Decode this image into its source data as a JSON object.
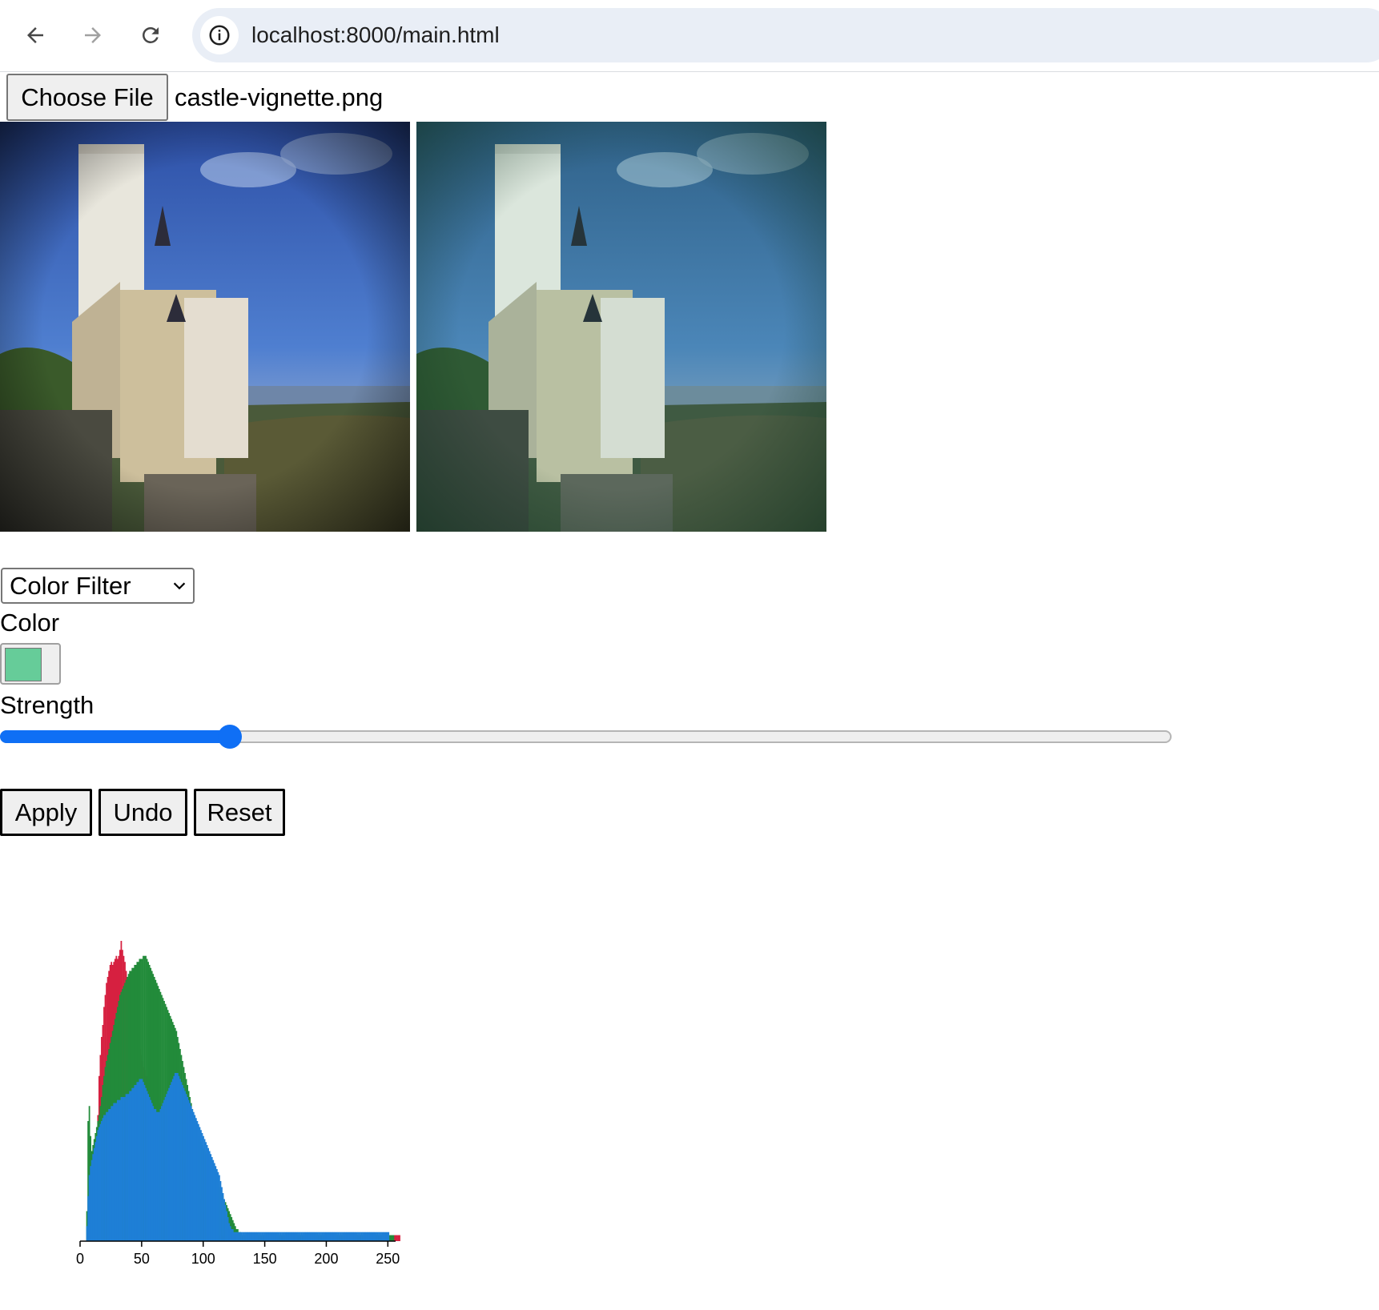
{
  "browser": {
    "url": "localhost:8000/main.html",
    "icons": [
      "back-arrow-icon",
      "forward-arrow-icon",
      "reload-icon",
      "site-info-icon"
    ]
  },
  "file_input": {
    "button_label": "Choose File",
    "file_name": "castle-vignette.png"
  },
  "filter": {
    "selected": "Color Filter",
    "color_label": "Color",
    "color_value": "#66cc99",
    "strength_label": "Strength",
    "strength_fraction": 0.19
  },
  "actions": {
    "apply_label": "Apply",
    "undo_label": "Undo",
    "reset_label": "Reset"
  },
  "chart_data": {
    "type": "bar",
    "title": "",
    "xlabel": "",
    "ylabel": "",
    "xlim": [
      0,
      255
    ],
    "x_ticks": [
      "0",
      "50",
      "100",
      "150",
      "200",
      "250"
    ],
    "series": [
      {
        "color": "#d62040",
        "values": [
          0,
          0,
          0,
          0,
          0,
          0,
          0,
          0,
          0,
          0,
          0.05,
          0.08,
          0.15,
          0.28,
          0.42,
          0.55,
          0.62,
          0.68,
          0.72,
          0.78,
          0.82,
          0.86,
          0.88,
          0.9,
          0.92,
          0.93,
          0.92,
          0.93,
          0.94,
          0.95,
          0.94,
          0.95,
          0.97,
          1.0,
          0.97,
          0.95,
          0.93,
          0.9,
          0.88,
          0.86,
          0.84,
          0.82,
          0.8,
          0.76,
          0.72,
          0.7,
          0.68,
          0.65,
          0.64,
          0.62,
          0.6,
          0.58,
          0.57,
          0.55,
          0.55,
          0.54,
          0.53,
          0.52,
          0.52,
          0.5,
          0.5,
          0.49,
          0.48,
          0.47,
          0.46,
          0.45,
          0.45,
          0.44,
          0.43,
          0.42,
          0.41,
          0.4,
          0.39,
          0.38,
          0.37,
          0.36,
          0.35,
          0.34,
          0.33,
          0.32,
          0.31,
          0.3,
          0.29,
          0.28,
          0.27,
          0.26,
          0.25,
          0.24,
          0.23,
          0.22,
          0.21,
          0.2,
          0.19,
          0.18,
          0.17,
          0.16,
          0.15,
          0.14,
          0.13,
          0.12,
          0.11,
          0.1,
          0.09,
          0.08,
          0.07,
          0.06,
          0.05,
          0.05,
          0.04,
          0.04,
          0.03,
          0.03,
          0.03,
          0.02,
          0.02,
          0.02,
          0.02,
          0.02,
          0.02,
          0.02,
          0.02,
          0.02,
          0.02,
          0.02,
          0.02,
          0.02,
          0.02,
          0.02,
          0.02,
          0.02,
          0.02,
          0.02,
          0.02,
          0.02,
          0.02,
          0.02,
          0.02,
          0.02,
          0.02,
          0.02,
          0.02,
          0.02,
          0.02,
          0.02,
          0.02,
          0.02,
          0.02,
          0.02,
          0.02,
          0.02,
          0.02,
          0.02,
          0.02,
          0.02,
          0.02,
          0.02,
          0.02,
          0.02,
          0.02,
          0.02,
          0.02,
          0.02,
          0.02,
          0.02,
          0.02,
          0.02,
          0.02,
          0.02,
          0.02,
          0.02,
          0.02,
          0.02,
          0.02,
          0.02,
          0.02,
          0.02,
          0.02,
          0.02,
          0.02,
          0.02,
          0.02,
          0.02,
          0.02,
          0.02,
          0.02,
          0.02,
          0.02,
          0.02,
          0.02,
          0.02,
          0.02,
          0.02,
          0.02,
          0.02,
          0.02,
          0.02,
          0.02,
          0.02,
          0.02,
          0.02,
          0.02,
          0.02,
          0.02,
          0.02,
          0.02,
          0.02,
          0.02,
          0.02,
          0.02,
          0.02,
          0.02,
          0.02,
          0.02,
          0.02,
          0.02,
          0.02,
          0.02,
          0.02,
          0.02,
          0.02,
          0.02,
          0.02,
          0.02,
          0.02,
          0.02,
          0.02,
          0.02,
          0.02,
          0.02,
          0.02,
          0.02,
          0.02,
          0.02,
          0.02,
          0.02,
          0.02,
          0.02,
          0.02,
          0.02,
          0.02,
          0.02,
          0.02,
          0.02,
          0.02,
          0.02,
          0.02,
          0.02,
          0.02,
          0.02,
          0.02,
          0.02,
          0.02,
          0.02,
          0.02,
          0.02,
          0.02,
          0.02,
          0.02,
          0.02,
          0.02,
          0.02
        ]
      },
      {
        "color": "#228b3a",
        "values": [
          0,
          0,
          0,
          0,
          0,
          0.1,
          0.4,
          0.45,
          0.35,
          0.3,
          0.32,
          0.34,
          0.36,
          0.38,
          0.4,
          0.42,
          0.45,
          0.48,
          0.52,
          0.55,
          0.58,
          0.6,
          0.62,
          0.64,
          0.66,
          0.68,
          0.7,
          0.72,
          0.74,
          0.76,
          0.78,
          0.8,
          0.82,
          0.83,
          0.84,
          0.85,
          0.86,
          0.87,
          0.88,
          0.89,
          0.9,
          0.9,
          0.91,
          0.91,
          0.92,
          0.92,
          0.93,
          0.93,
          0.94,
          0.94,
          0.94,
          0.95,
          0.95,
          0.95,
          0.94,
          0.93,
          0.92,
          0.91,
          0.9,
          0.89,
          0.88,
          0.87,
          0.86,
          0.85,
          0.84,
          0.83,
          0.82,
          0.81,
          0.8,
          0.79,
          0.78,
          0.77,
          0.76,
          0.75,
          0.74,
          0.73,
          0.72,
          0.71,
          0.7,
          0.68,
          0.66,
          0.64,
          0.62,
          0.6,
          0.58,
          0.56,
          0.54,
          0.52,
          0.5,
          0.48,
          0.46,
          0.44,
          0.42,
          0.4,
          0.38,
          0.36,
          0.35,
          0.34,
          0.33,
          0.32,
          0.31,
          0.3,
          0.29,
          0.28,
          0.27,
          0.26,
          0.25,
          0.24,
          0.23,
          0.22,
          0.21,
          0.2,
          0.19,
          0.18,
          0.17,
          0.16,
          0.15,
          0.14,
          0.13,
          0.12,
          0.11,
          0.1,
          0.09,
          0.08,
          0.07,
          0.06,
          0.05,
          0.04,
          0.04,
          0.03,
          0.03,
          0.02,
          0.02,
          0.02,
          0.02,
          0.02,
          0.02,
          0.02,
          0.02,
          0.02,
          0.02,
          0.02,
          0.02,
          0.02,
          0.02,
          0.02,
          0.02,
          0.02,
          0.02,
          0.02,
          0.02,
          0.02,
          0.02,
          0.02,
          0.02,
          0.02,
          0.02,
          0.02,
          0.02,
          0.02,
          0.02,
          0.02,
          0.02,
          0.02,
          0.02,
          0.02,
          0.02,
          0.02,
          0.02,
          0.02,
          0.02,
          0.02,
          0.02,
          0.02,
          0.02,
          0.02,
          0.02,
          0.02,
          0.02,
          0.02,
          0.02,
          0.02,
          0.02,
          0.02,
          0.02,
          0.02,
          0.02,
          0.02,
          0.02,
          0.02,
          0.02,
          0.02,
          0.02,
          0.02,
          0.02,
          0.02,
          0.02,
          0.02,
          0.02,
          0.02,
          0.02,
          0.02,
          0.02,
          0.02,
          0.02,
          0.02,
          0.02,
          0.02,
          0.02,
          0.02,
          0.02,
          0.02,
          0.02,
          0.02,
          0.02,
          0.02,
          0.02,
          0.02,
          0.02,
          0.02,
          0.02,
          0.02,
          0.02,
          0.02,
          0.02,
          0.02,
          0.02,
          0.02,
          0.02,
          0.02,
          0.02,
          0.02,
          0.02,
          0.02,
          0.02,
          0.02,
          0.02,
          0.02,
          0.02,
          0.02,
          0.02,
          0.02,
          0.02,
          0.02,
          0.02,
          0.02,
          0.02,
          0.02,
          0.02,
          0.02,
          0.02,
          0.02,
          0.02,
          0.02,
          0.02,
          0.02
        ]
      },
      {
        "color": "#1e7fd6",
        "values": [
          0,
          0,
          0,
          0,
          0,
          0.05,
          0.15,
          0.22,
          0.25,
          0.27,
          0.29,
          0.31,
          0.33,
          0.35,
          0.37,
          0.38,
          0.39,
          0.4,
          0.41,
          0.42,
          0.42,
          0.43,
          0.43,
          0.44,
          0.44,
          0.45,
          0.45,
          0.46,
          0.46,
          0.46,
          0.47,
          0.47,
          0.47,
          0.48,
          0.48,
          0.48,
          0.48,
          0.49,
          0.49,
          0.49,
          0.5,
          0.5,
          0.51,
          0.51,
          0.52,
          0.52,
          0.53,
          0.53,
          0.54,
          0.54,
          0.54,
          0.53,
          0.52,
          0.51,
          0.5,
          0.49,
          0.48,
          0.47,
          0.46,
          0.45,
          0.44,
          0.44,
          0.43,
          0.43,
          0.43,
          0.44,
          0.45,
          0.46,
          0.47,
          0.48,
          0.49,
          0.5,
          0.51,
          0.52,
          0.53,
          0.54,
          0.55,
          0.56,
          0.56,
          0.56,
          0.55,
          0.54,
          0.53,
          0.52,
          0.51,
          0.5,
          0.49,
          0.48,
          0.47,
          0.46,
          0.45,
          0.44,
          0.43,
          0.42,
          0.41,
          0.4,
          0.39,
          0.38,
          0.37,
          0.36,
          0.35,
          0.34,
          0.33,
          0.32,
          0.31,
          0.3,
          0.29,
          0.28,
          0.27,
          0.26,
          0.25,
          0.24,
          0.23,
          0.22,
          0.2,
          0.18,
          0.16,
          0.14,
          0.12,
          0.1,
          0.08,
          0.06,
          0.05,
          0.04,
          0.04,
          0.03,
          0.03,
          0.03,
          0.03,
          0.03,
          0.03,
          0.03,
          0.03,
          0.03,
          0.03,
          0.03,
          0.03,
          0.03,
          0.03,
          0.03,
          0.03,
          0.03,
          0.03,
          0.03,
          0.03,
          0.03,
          0.03,
          0.03,
          0.03,
          0.03,
          0.03,
          0.03,
          0.03,
          0.03,
          0.03,
          0.03,
          0.03,
          0.03,
          0.03,
          0.03,
          0.03,
          0.03,
          0.03,
          0.03,
          0.03,
          0.03,
          0.03,
          0.03,
          0.03,
          0.03,
          0.03,
          0.03,
          0.03,
          0.03,
          0.03,
          0.03,
          0.03,
          0.03,
          0.03,
          0.03,
          0.03,
          0.03,
          0.03,
          0.03,
          0.03,
          0.03,
          0.03,
          0.03,
          0.03,
          0.03,
          0.03,
          0.03,
          0.03,
          0.03,
          0.03,
          0.03,
          0.03,
          0.03,
          0.03,
          0.03,
          0.03,
          0.03,
          0.03,
          0.03,
          0.03,
          0.03,
          0.03,
          0.03,
          0.03,
          0.03,
          0.03,
          0.03,
          0.03,
          0.03,
          0.03,
          0.03,
          0.03,
          0.03,
          0.03,
          0.03,
          0.03,
          0.03,
          0.03,
          0.03,
          0.03,
          0.03,
          0.03,
          0.03,
          0.03,
          0.03,
          0.03,
          0.03,
          0.03,
          0.03,
          0.03,
          0.03,
          0.03,
          0.03,
          0.03,
          0.03,
          0.03,
          0.03,
          0.03,
          0.03,
          0.03,
          0.03,
          0.03,
          0.03,
          0.03,
          0.03,
          0.03,
          0.03
        ]
      }
    ]
  }
}
